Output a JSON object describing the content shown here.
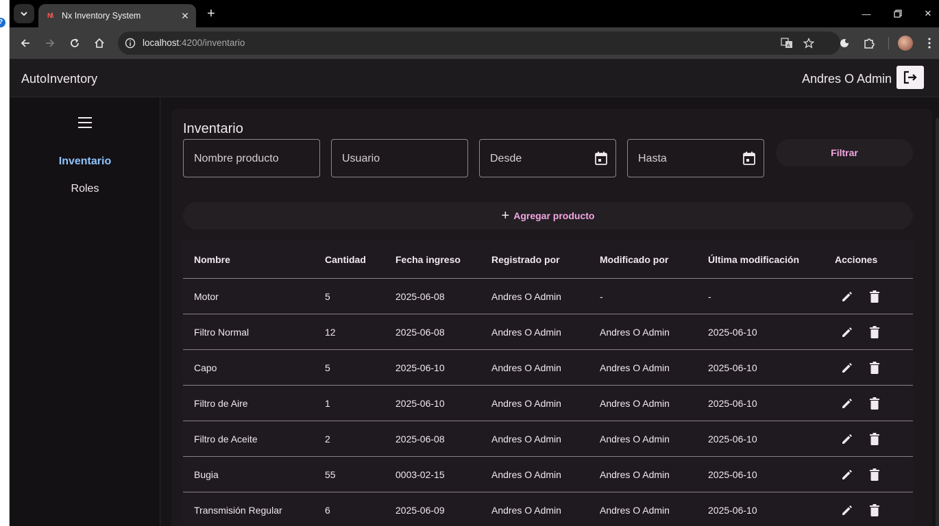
{
  "browser": {
    "tab_title": "Nx Inventory System",
    "favicon_text": "N\\",
    "url_host": "localhost",
    "url_path": ":4200/inventario"
  },
  "app": {
    "brand": "AutoInventory",
    "user_name": "Andres O Admin"
  },
  "sidebar": {
    "items": [
      {
        "label": "Inventario",
        "active": true
      },
      {
        "label": "Roles",
        "active": false
      }
    ]
  },
  "main": {
    "title": "Inventario",
    "filters": {
      "product_name_label": "Nombre producto",
      "user_label": "Usuario",
      "from_label": "Desde",
      "to_label": "Hasta",
      "filter_button": "Filtrar"
    },
    "add_button": "Agregar producto",
    "table": {
      "columns": [
        "Nombre",
        "Cantidad",
        "Fecha ingreso",
        "Registrado por",
        "Modificado por",
        "Última modificación",
        "Acciones"
      ],
      "rows": [
        [
          "Motor",
          "5",
          "2025-06-08",
          "Andres O Admin",
          "-",
          "-"
        ],
        [
          "Filtro Normal",
          "12",
          "2025-06-08",
          "Andres O Admin",
          "Andres O Admin",
          "2025-06-10"
        ],
        [
          "Capo",
          "5",
          "2025-06-10",
          "Andres O Admin",
          "Andres O Admin",
          "2025-06-10"
        ],
        [
          "Filtro de Aire",
          "1",
          "2025-06-10",
          "Andres O Admin",
          "Andres O Admin",
          "2025-06-10"
        ],
        [
          "Filtro de Aceite",
          "2",
          "2025-06-08",
          "Andres O Admin",
          "Andres O Admin",
          "2025-06-10"
        ],
        [
          "Bugia",
          "55",
          "0003-02-15",
          "Andres O Admin",
          "Andres O Admin",
          "2025-06-10"
        ],
        [
          "Transmisión Regular",
          "6",
          "2025-06-09",
          "Andres O Admin",
          "Andres O Admin",
          "2025-06-10"
        ]
      ]
    }
  },
  "colors": {
    "accent_pink": "#f5a7e3",
    "active_nav_blue": "#8fc4ff",
    "page_bg": "#171417"
  },
  "icons": {
    "edit": "pencil-icon",
    "delete": "trash-icon",
    "calendar": "calendar-icon",
    "logout": "logout-icon",
    "menu": "hamburger-icon"
  }
}
